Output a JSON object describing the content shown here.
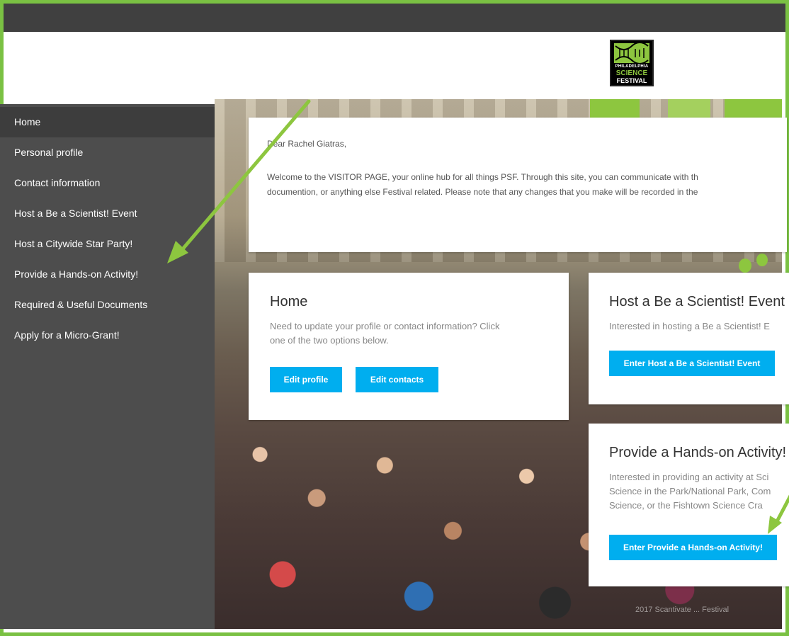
{
  "logo": {
    "line1": "PHILADELPHIA",
    "line2": "SCIENCE",
    "line3": "FESTIVAL",
    "colors": {
      "green": "#8dc63f",
      "black": "#000000"
    }
  },
  "sidebar": {
    "items": [
      {
        "label": "Home",
        "active": true
      },
      {
        "label": "Personal profile"
      },
      {
        "label": "Contact information"
      },
      {
        "label": "Host a Be a Scientist! Event"
      },
      {
        "label": "Host a Citywide Star Party!"
      },
      {
        "label": "Provide a Hands-on Activity!"
      },
      {
        "label": "Required & Useful Documents"
      },
      {
        "label": "Apply for a Micro-Grant!"
      }
    ]
  },
  "welcome": {
    "greeting": "Dear Rachel Giatras,",
    "line1": "Welcome to the VISITOR PAGE, your online hub for all things PSF. Through this site, you can communicate with th",
    "line2": "documention, or anything else Festival related. Please note that any changes that you make will be recorded in the"
  },
  "cards": {
    "home": {
      "title": "Home",
      "text1": "Need to update your profile or contact information? Click",
      "text2": "one of the two options below.",
      "btn_profile": "Edit profile",
      "btn_contacts": "Edit contacts"
    },
    "be_scientist": {
      "title": "Host a Be a Scientist! Event",
      "text1": "Interested in hosting a Be a Scientist! E",
      "btn": "Enter Host a Be a Scientist! Event"
    },
    "hands_on": {
      "title": "Provide a Hands-on Activity!",
      "text1": "Interested in providing an activity at Sci",
      "text2": "Science in the Park/National Park, Com",
      "text3": "Science, or the Fishtown Science Cra",
      "btn": "Enter Provide a Hands-on Activity!"
    }
  },
  "footer": {
    "text": "2017 Scantivate ... Festival"
  },
  "colors": {
    "frame": "#7ac143",
    "topbar": "#404040",
    "sidebar": "#4d4d4d",
    "button": "#00aeef",
    "arrow": "#8dc63f"
  }
}
